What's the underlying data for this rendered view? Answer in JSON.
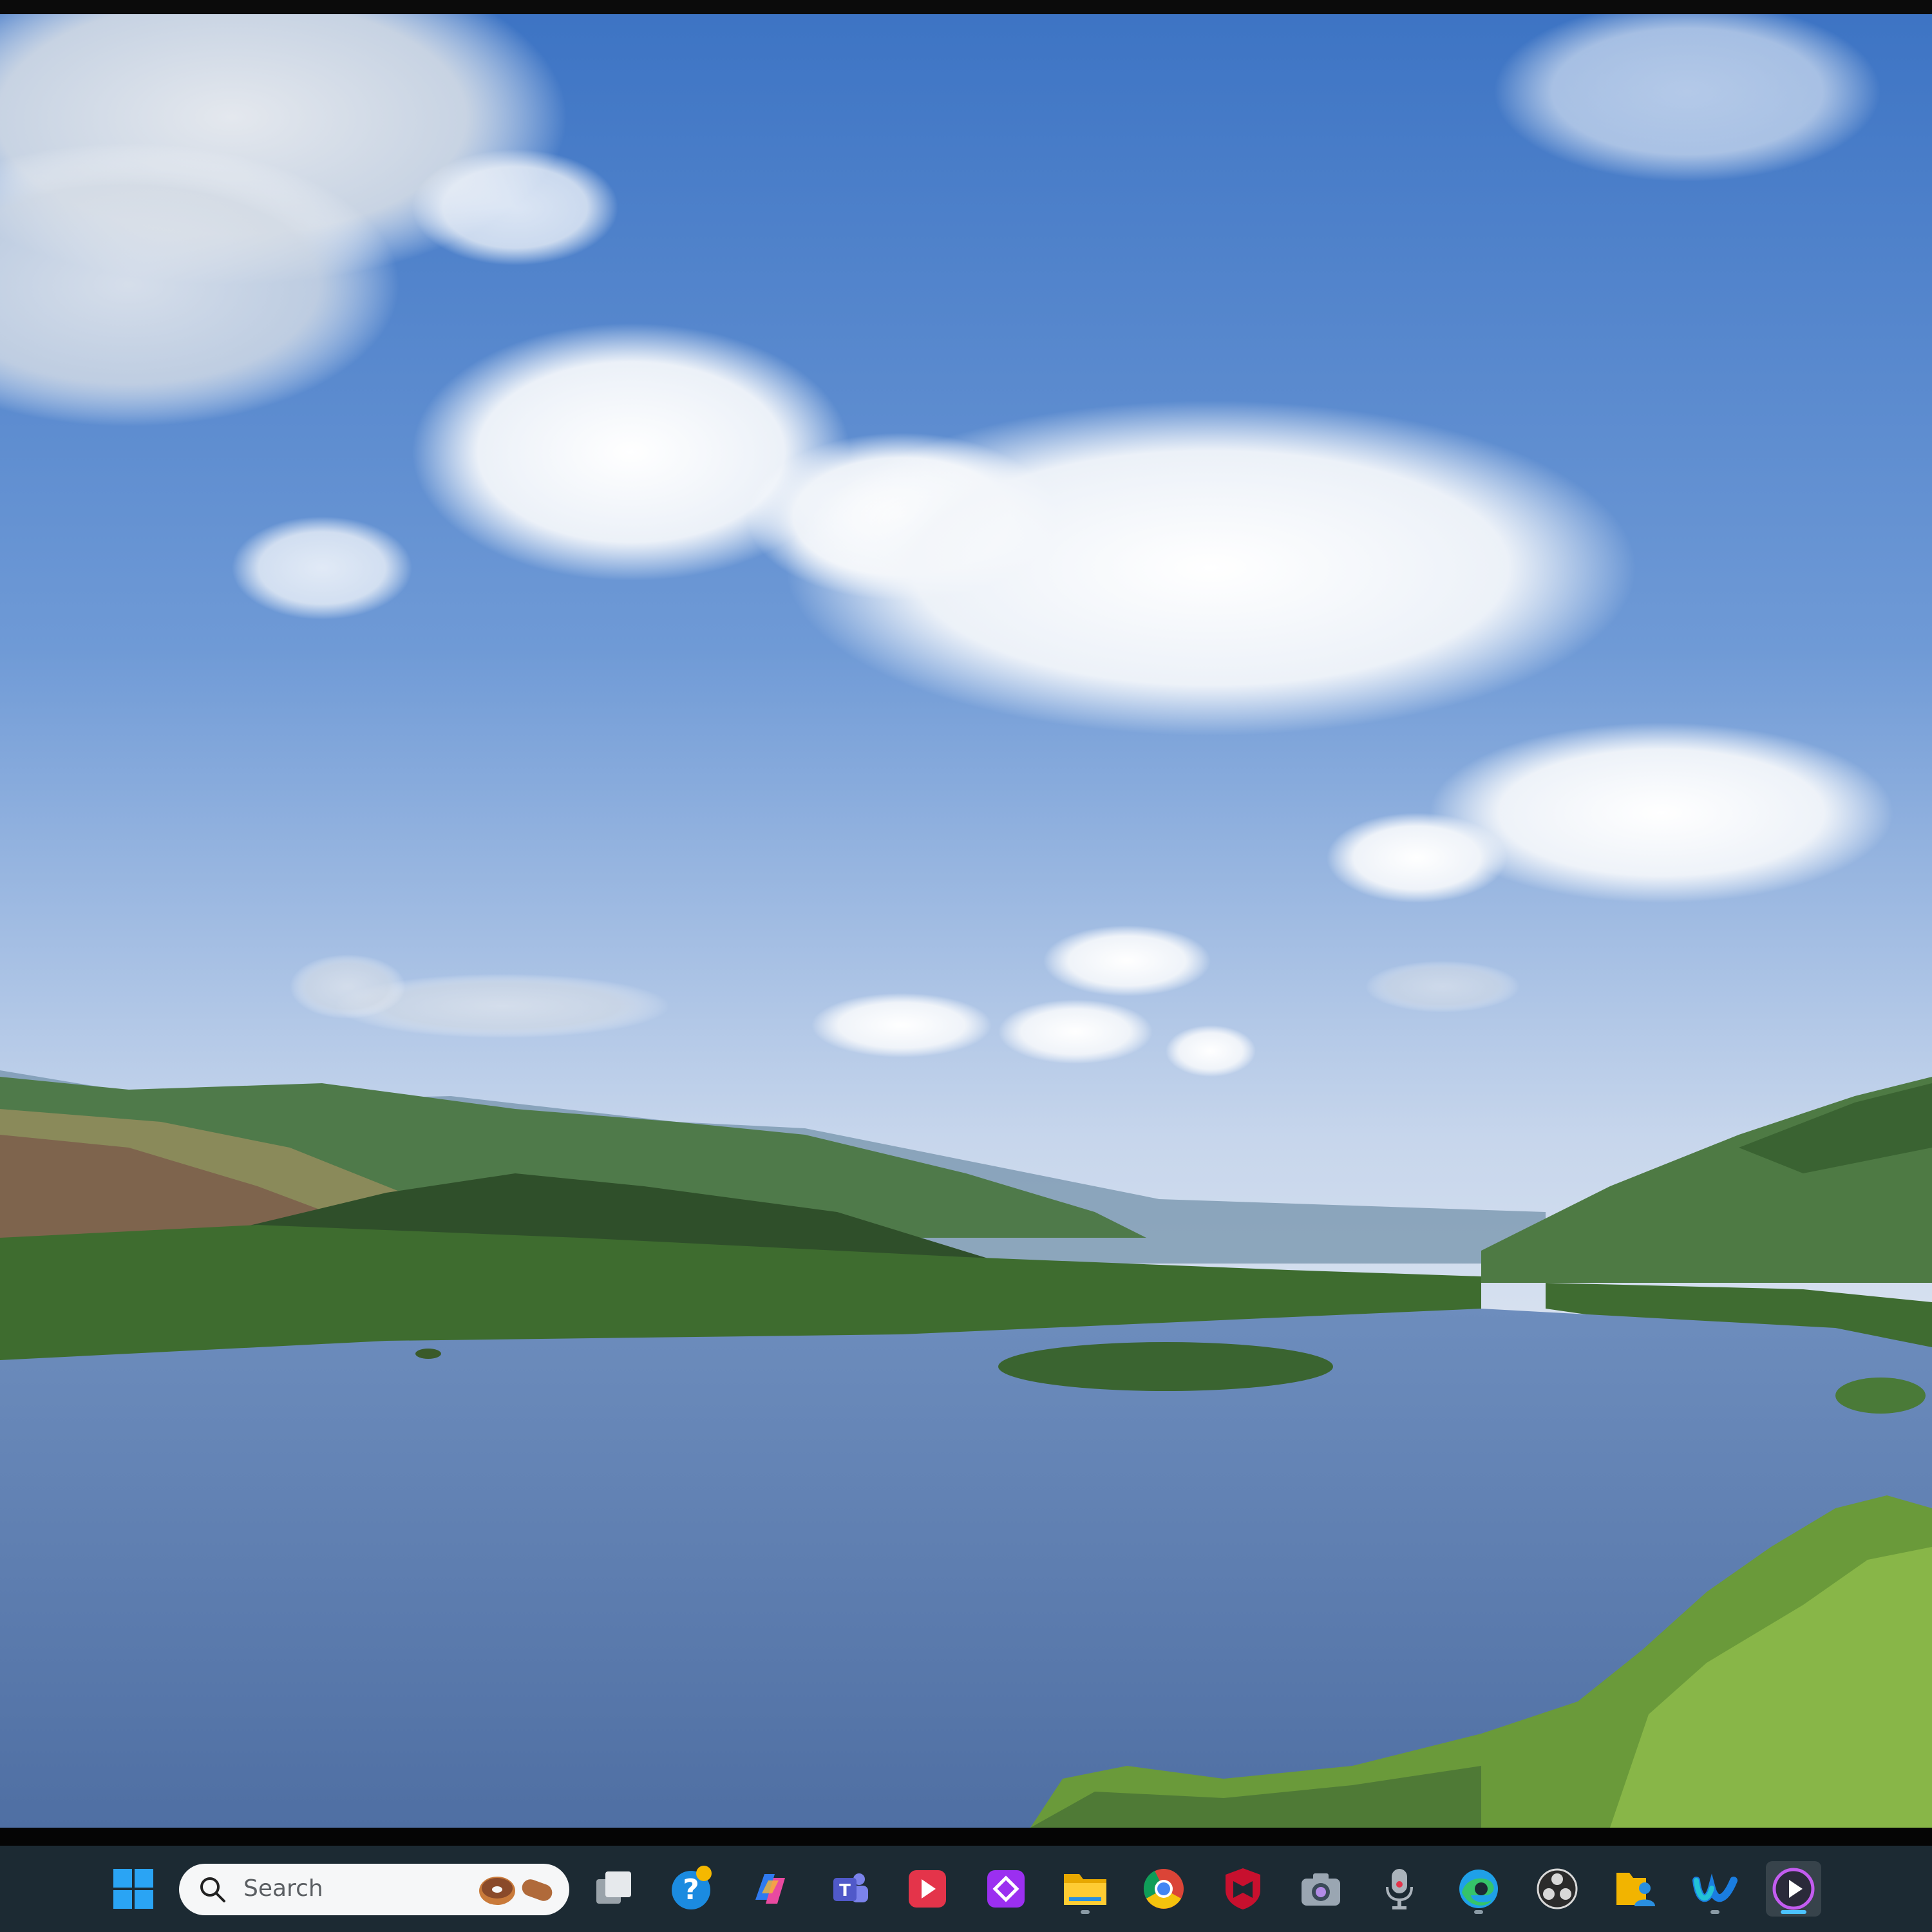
{
  "wallpaper": {
    "description_icon": "landscape-lake-wallpaper",
    "colors": {
      "sky_top": "#3f78c8",
      "sky_mid": "#8fb1de",
      "sky_horizon": "#dfe6f0",
      "lake": "#5d7fb0",
      "hills": "#3f6e35"
    }
  },
  "taskbar": {
    "search": {
      "placeholder": "Search",
      "icon": "search-icon",
      "highlight_icon": "donut-and-bread-icon"
    },
    "apps": [
      {
        "name": "start",
        "icon": "windows-logo-icon"
      },
      {
        "name": "task-view",
        "icon": "task-view-icon"
      },
      {
        "name": "get-help",
        "icon": "help-icon",
        "badge": true
      },
      {
        "name": "copilot",
        "icon": "copilot-icon"
      },
      {
        "name": "teams",
        "icon": "teams-icon"
      },
      {
        "name": "media-player",
        "icon": "play-red-icon"
      },
      {
        "name": "purple-app",
        "icon": "purple-diamond-icon"
      },
      {
        "name": "file-explorer",
        "icon": "folder-icon",
        "running": true
      },
      {
        "name": "chrome",
        "icon": "chrome-icon"
      },
      {
        "name": "mcafee",
        "icon": "shield-red-icon"
      },
      {
        "name": "camera",
        "icon": "camera-icon"
      },
      {
        "name": "voice-recorder",
        "icon": "microphone-icon"
      },
      {
        "name": "edge",
        "icon": "edge-icon",
        "running": true
      },
      {
        "name": "obs",
        "icon": "obs-icon"
      },
      {
        "name": "files-app",
        "icon": "folder-person-icon"
      },
      {
        "name": "webex",
        "icon": "webex-icon",
        "running": true
      },
      {
        "name": "clipchamp",
        "icon": "play-circle-icon",
        "active": true
      }
    ]
  }
}
